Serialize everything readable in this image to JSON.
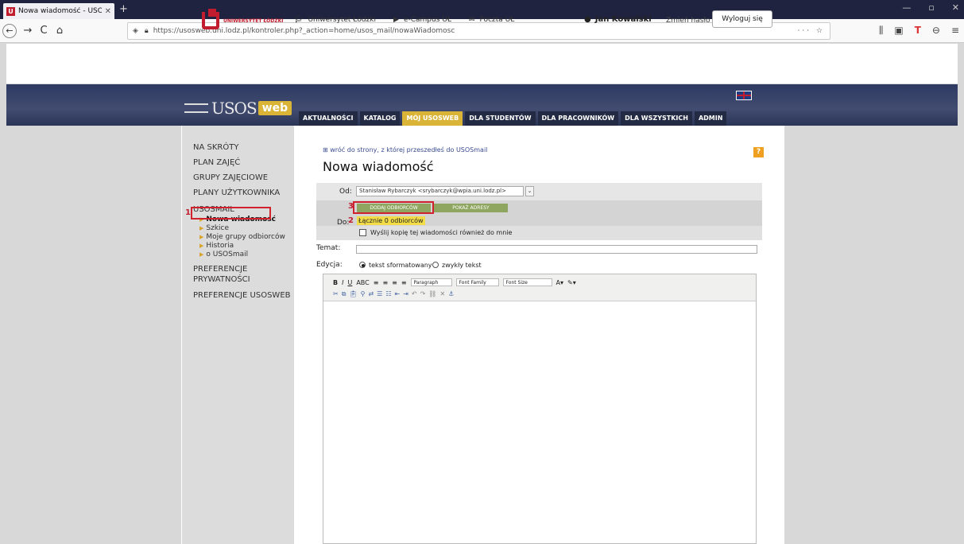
{
  "browser": {
    "tab_title": "Nowa wiadomość - USOSmai",
    "tab_close": "✕",
    "new_tab": "+",
    "url": "https://usosweb.uni.lodz.pl/kontroler.php?_action=home/usos_mail/nowaWiadomosc",
    "url_right": "··· ☆",
    "window_controls": [
      "—",
      "▫",
      "✕"
    ]
  },
  "site": {
    "logo_text": "UNIWERSYTET ŁÓDZKI",
    "links": [
      {
        "icon": "graduation-cap-icon",
        "label": "Uniwersytet Łódzki"
      },
      {
        "icon": "play-icon",
        "label": "e-Campus UŁ"
      },
      {
        "icon": "mail-icon",
        "label": "Poczta UŁ"
      }
    ],
    "user_name": "Jan Kowalski",
    "change_password": "Zmień hasło",
    "logout": "Wyloguj się"
  },
  "header": {
    "usos": "USOS",
    "web": "web",
    "menu": [
      {
        "label": "AKTUALNOŚCI",
        "active": false
      },
      {
        "label": "KATALOG",
        "active": false
      },
      {
        "label": "MÓJ USOSWEB",
        "active": true
      },
      {
        "label": "DLA STUDENTÓW",
        "active": false
      },
      {
        "label": "DLA PRACOWNIKÓW",
        "active": false
      },
      {
        "label": "DLA WSZYSTKICH",
        "active": false
      },
      {
        "label": "ADMIN",
        "active": false
      }
    ]
  },
  "sidebar": {
    "sections": [
      "NA SKRÓTY",
      "PLAN ZAJĘĆ",
      "GRUPY ZAJĘCIOWE",
      "PLANY UŻYTKOWNIKA",
      "USOSMAIL"
    ],
    "sub_items": [
      "Nowa wiadomość",
      "Szkice",
      "Moje grupy odbiorców",
      "Historia",
      "o USOSmail"
    ],
    "pref_priv_1": "PREFERENCJE",
    "pref_priv_2": "PRYWATNOŚCI",
    "pref_usos": "PREFERENCJE USOSWEB"
  },
  "main": {
    "back_link": "⊞ wróć do strony, z której przeszedłeś do USOSmail",
    "help": "?",
    "title": "Nowa wiadomość",
    "od_label": "Od:",
    "od_value": "Stanisław Rybarczyk <srybarczyk@wpia.uni.lodz.pl>",
    "do_label": "Do:",
    "add_recipients": "DODAJ ODBIORCÓW",
    "show_addresses": "POKAŻ ADRESY",
    "count": "Łącznie 0 odbiorców",
    "copy_label": "Wyślij kopię tej wiadomości również do mnie",
    "temat_label": "Temat:",
    "edycja_label": "Edycja:",
    "radio_formatted": "tekst sformatowany",
    "radio_plain": "zwykły tekst",
    "editor": {
      "format_paragraph": "Paragraph",
      "font_family": "Font Family",
      "font_size": "Font Size"
    }
  },
  "annotations": {
    "m1": "1",
    "m2": "2",
    "m3": "3"
  }
}
